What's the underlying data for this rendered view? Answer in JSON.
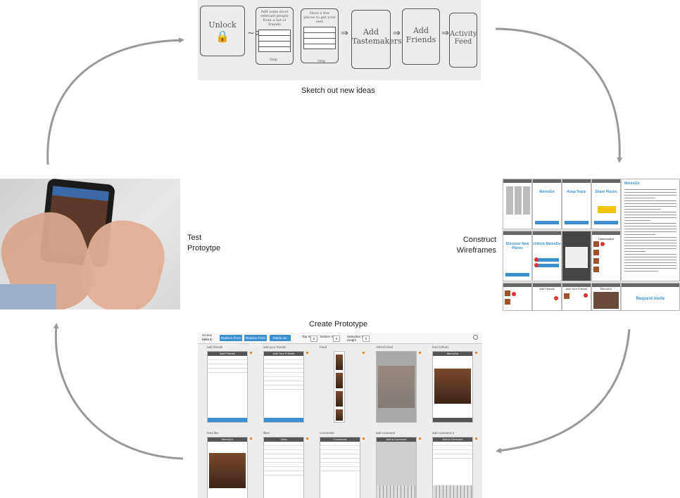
{
  "labels": {
    "sketch": "Sketch out new ideas",
    "wireframes": "Construct\nWireframes",
    "prototype": "Create Prototype",
    "test": "Test\nProtoytpe"
  },
  "sketch_panel": {
    "boxes": [
      "Unlock",
      "Add some most relevant people from a list of friends",
      "Have a few places to get your own",
      "Add Tastemakers",
      "Add Friends",
      "Activity Feed"
    ],
    "sub_labels": [
      "Skip",
      "Skip"
    ]
  },
  "wireframes_panel": {
    "titles": [
      "MemoGo",
      "Keep Track",
      "Share Places",
      "Discover New Places",
      "Unlock MemoGo",
      "Tastemakers",
      "Add Friends",
      "Add Your Friends",
      "MemoGo",
      "Request Invite"
    ]
  },
  "prototype_panel": {
    "toolbar": {
      "screen_label": "Screen",
      "screen_value": "intro 1",
      "buttons": [
        "Replace From Computer",
        "Replace From Dropbox",
        "Delete scr."
      ],
      "tap_size_label": "Tap Size",
      "bottom_size_label": "Bottom Size",
      "statusbar_label": "Statusbar Trim Height",
      "tap_size_value": "0",
      "bottom_size_value": "0",
      "statusbar_value": "0"
    },
    "screens_row1": [
      {
        "caption": "add friends",
        "title": "Add Friends"
      },
      {
        "caption": "add your friends",
        "title": "Add Your Friends"
      },
      {
        "caption": "Feed",
        "title": ""
      },
      {
        "caption": "refresh feed",
        "title": ""
      },
      {
        "caption": "feed (short)",
        "title": "MemoGo"
      }
    ],
    "screens_row2": [
      {
        "caption": "feed like",
        "title": "MemoGo"
      },
      {
        "caption": "likes",
        "title": "Likes"
      },
      {
        "caption": "comments",
        "title": "Comments"
      },
      {
        "caption": "add comment",
        "title": "Add a Comment"
      },
      {
        "caption": "add comment 2",
        "title": "Add a Comment"
      }
    ]
  },
  "colors": {
    "arrow": "#999999",
    "accent": "#3a8fd0",
    "badge": "#d33333"
  }
}
